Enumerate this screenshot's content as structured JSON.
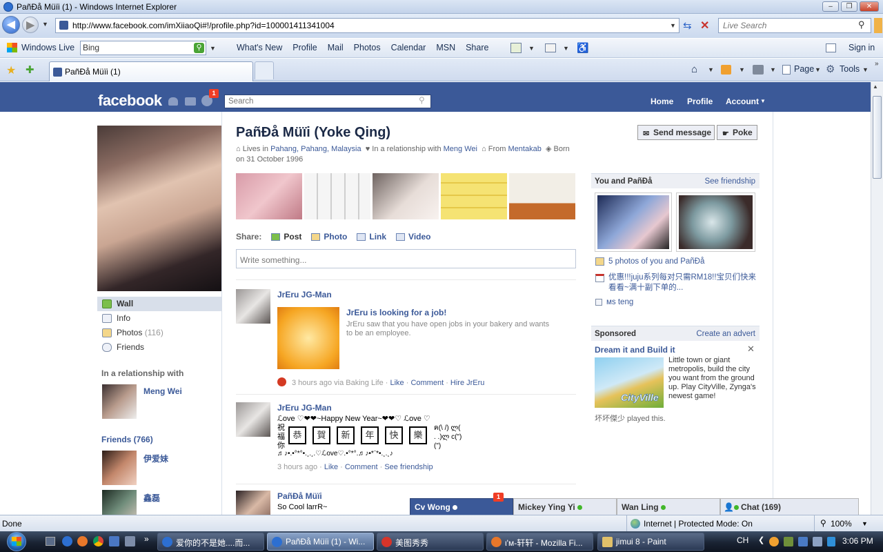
{
  "window": {
    "title": "PañĐå Müïi (1) - Windows Internet Explorer"
  },
  "address": {
    "url": "http://www.facebook.com/imXiiaoQi#!/profile.php?id=100001411341004",
    "search_placeholder": "Live Search"
  },
  "links_toolbar": {
    "brand": "Windows Live",
    "bing_value": "Bing",
    "items": [
      "What's New",
      "Profile",
      "Mail",
      "Photos",
      "Calendar",
      "MSN",
      "Share"
    ],
    "signin": "Sign in"
  },
  "tabs": {
    "active": "PañĐå Müïi (1)",
    "page_label": "Page",
    "tools_label": "Tools"
  },
  "fb": {
    "logo": "facebook",
    "notif_count": "1",
    "search_placeholder": "Search",
    "nav": [
      "Home",
      "Profile",
      "Account"
    ],
    "profile_name": "PañĐå Müïi (Yoke Qing)",
    "info": {
      "lives_prefix": "Lives in",
      "lives_link": "Pahang, Pahang, Malaysia",
      "rel_prefix": "In a relationship with",
      "rel_link": "Meng Wei",
      "from_prefix": "From",
      "from_link": "Mentakab",
      "born": "Born on 31 October 1996"
    },
    "buttons": {
      "send_message": "Send message",
      "poke": "Poke"
    },
    "left_nav": [
      {
        "label": "Wall"
      },
      {
        "label": "Info"
      },
      {
        "label": "Photos",
        "count": "(116)"
      },
      {
        "label": "Friends"
      }
    ],
    "relationship_head": "In a relationship with",
    "relationship_name": "Meng Wei",
    "friends_head": "Friends (766)",
    "friends": [
      "伊爱妹",
      "鑫磊"
    ],
    "share": {
      "label": "Share:",
      "items": [
        "Post",
        "Photo",
        "Link",
        "Video"
      ],
      "write_placeholder": "Write something..."
    },
    "stories": [
      {
        "author": "JrEru JG-Man",
        "title": "JrEru is looking for a job!",
        "body": "JrEru saw that you have open jobs in your bakery and wants to be an employee.",
        "time": "3 hours ago via Baking Life",
        "actions": [
          "Like",
          "Comment",
          "Hire JrEru"
        ]
      },
      {
        "author": "JrEru JG-Man",
        "line1": "ℒove ♡❤❤~Happy New Year~❤❤♡ ℒove ♡",
        "line2": "祝 福 你",
        "boxes": [
          "恭",
          "賀",
          "新",
          "年",
          "快",
          "樂"
        ],
        "emoticon": "ฅ(\\ /) ლ( . .)ლ c(\")(\")",
        "line3": "♬♪•.•°*°•.¸.¸.♡ℒove♡.•°*°.♬♪•*¨*•.¸.¸♪",
        "time": "3 hours ago",
        "actions": [
          "Like",
          "Comment",
          "See friendship"
        ]
      },
      {
        "author": "PañĐå Müïi",
        "body": "So Cool larrR~"
      }
    ],
    "right": {
      "you_and": "You and PañĐå",
      "see_friendship": "See friendship",
      "photos_link": "5 photos of you and PañĐå",
      "event_link": "优惠!!!juju系列每对只需RM18!!宝贝们快来看看~满十副下单的...",
      "ms_link": "ᴍs teng",
      "sponsored": "Sponsored",
      "create_advert": "Create an advert",
      "ad_title": "Dream it and Build it",
      "ad_body": "Little town or giant metropolis, build the city you want from the ground up. Play CityVille, Zynga's newest game!",
      "ad_logo": "CityVille",
      "ad_social": "坏坏傑少 played this."
    }
  },
  "chat": {
    "tabs": [
      "Cv Wong",
      "Mickey Ying Yi",
      "Wan Ling"
    ],
    "badge": "1",
    "chat_label": "Chat (169)"
  },
  "status": {
    "left": "Done",
    "zone": "Internet | Protected Mode: On",
    "zoom": "100%"
  },
  "taskbar": {
    "tasks": [
      "爱你的不是她....而...",
      "PañĐå Müïi (1) - Wi...",
      "美图秀秀",
      "ι'м-轩轩 - Mozilla Fi...",
      "jimui 8 - Paint"
    ],
    "lang": "CH",
    "clock": "3:06 PM"
  }
}
